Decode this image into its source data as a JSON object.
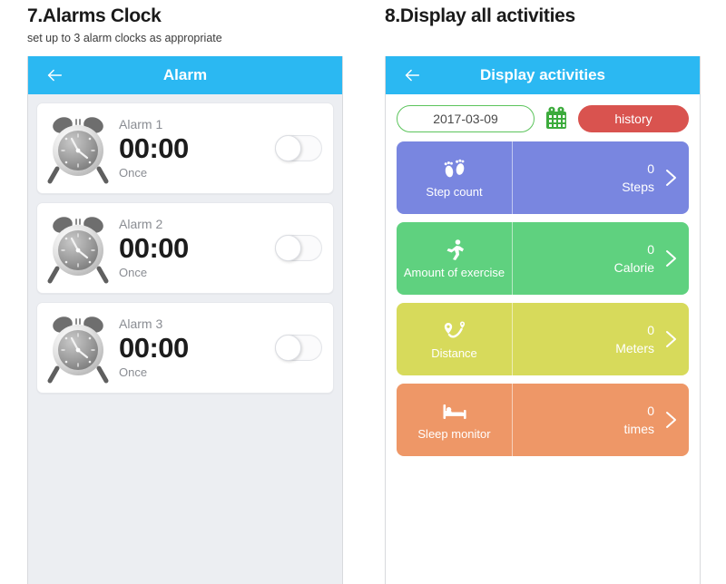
{
  "sections": {
    "left": {
      "title": "7.Alarms Clock",
      "subtitle": "set up to 3 alarm clocks as appropriate"
    },
    "right": {
      "title": "8.Display all activities",
      "subtitle": ""
    }
  },
  "alarm_screen": {
    "appbar": {
      "title": "Alarm",
      "back_icon": "back-arrow-icon",
      "background": "#2bb8f2"
    },
    "alarms": [
      {
        "name": "Alarm 1",
        "time": "00:00",
        "repeat": "Once",
        "enabled": false,
        "icon": "alarm-clock-icon"
      },
      {
        "name": "Alarm 2",
        "time": "00:00",
        "repeat": "Once",
        "enabled": false,
        "icon": "alarm-clock-icon"
      },
      {
        "name": "Alarm 3",
        "time": "00:00",
        "repeat": "Once",
        "enabled": false,
        "icon": "alarm-clock-icon"
      }
    ]
  },
  "activities_screen": {
    "appbar": {
      "title": "Display activities",
      "back_icon": "back-arrow-icon",
      "background": "#2bb8f2"
    },
    "date_bar": {
      "date_value": "2017-03-09",
      "calendar_icon": "calendar-icon",
      "history_label": "history",
      "history_color": "#d9534f",
      "date_border_color": "#5cc45c"
    },
    "activities": [
      {
        "label": "Step count",
        "value": "0",
        "unit": "Steps",
        "color": "#7986e0",
        "icon": "footprints-icon"
      },
      {
        "label": "Amount of exercise",
        "value": "0",
        "unit": "Calorie",
        "color": "#5fd17f",
        "icon": "runner-icon"
      },
      {
        "label": "Distance",
        "value": "0",
        "unit": "Meters",
        "color": "#d7da5b",
        "icon": "route-pin-icon"
      },
      {
        "label": "Sleep monitor",
        "value": "0",
        "unit": "times",
        "color": "#ee9767",
        "icon": "bed-icon"
      }
    ],
    "chevron_icon": "chevron-right-icon"
  }
}
